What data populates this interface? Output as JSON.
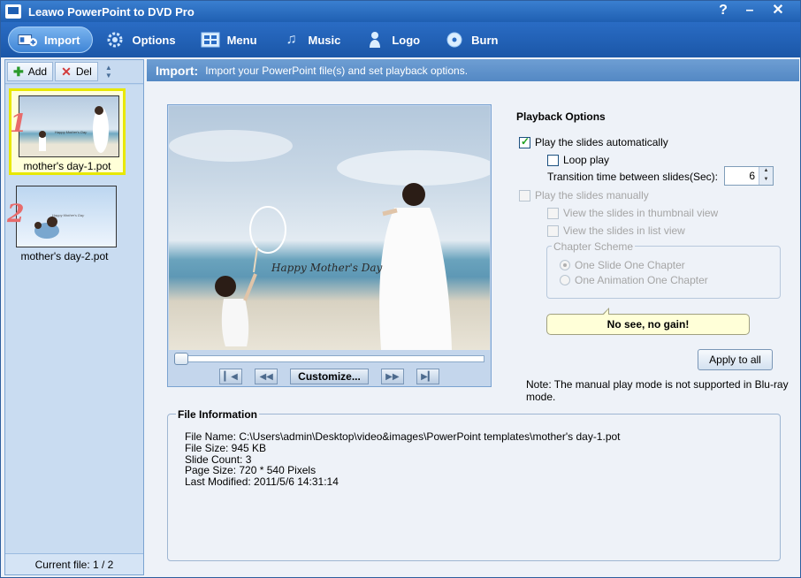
{
  "window": {
    "title": "Leawo PowerPoint to DVD Pro",
    "help_label": "?",
    "minimize_label": "–",
    "close_label": "✕"
  },
  "toolbar": {
    "items": [
      {
        "label": "Import",
        "icon": "import-icon",
        "active": true
      },
      {
        "label": "Options",
        "icon": "gear-icon"
      },
      {
        "label": "Menu",
        "icon": "menu-icon"
      },
      {
        "label": "Music",
        "icon": "music-note-icon"
      },
      {
        "label": "Logo",
        "icon": "person-icon"
      },
      {
        "label": "Burn",
        "icon": "disc-icon"
      }
    ]
  },
  "file_panel": {
    "add_label": "Add",
    "del_label": "Del",
    "files": [
      {
        "num": "1",
        "name": "mother's day-1.pot",
        "selected": true,
        "thumb_caption": "Happy Mother's Day"
      },
      {
        "num": "2",
        "name": "mother's day-2.pot",
        "selected": false,
        "thumb_caption": "Happy Mother's Day"
      }
    ],
    "current_file": "Current file: 1 / 2"
  },
  "header": {
    "title": "Import:",
    "description": "Import your PowerPoint file(s) and set playback options."
  },
  "preview": {
    "caption": "Happy Mother's Day",
    "customize_label": "Customize...",
    "progress": 0
  },
  "playback": {
    "title": "Playback Options",
    "auto_label": "Play the slides automatically",
    "auto_checked": true,
    "loop_label": "Loop play",
    "loop_checked": false,
    "transition_label": "Transition time between slides(Sec):",
    "transition_value": "6",
    "manual_label": "Play the slides manually",
    "thumbnail_label": "View the slides in thumbnail view",
    "list_label": "View the slides in list view",
    "chapter_legend": "Chapter Scheme",
    "chapter_options": [
      "One Slide One Chapter",
      "One Animation One Chapter"
    ],
    "tip": "No see, no gain!",
    "apply_label": "Apply to all",
    "note": "Note: The manual play mode is not supported in Blu-ray mode."
  },
  "file_info": {
    "title": "File Information",
    "lines": [
      "File Name: C:\\Users\\admin\\Desktop\\video&images\\PowerPoint templates\\mother's day-1.pot",
      "File Size: 945 KB",
      "Slide Count: 3",
      "Page Size: 720 * 540 Pixels",
      "Last Modified: 2011/5/6 14:31:14"
    ]
  },
  "colors": {
    "titlebar": "#1f5fb2",
    "toolbar": "#2a6cc4",
    "panel": "#bcd3ec",
    "selected_border": "#e8e800",
    "tip_bg": "#ffffd8"
  }
}
